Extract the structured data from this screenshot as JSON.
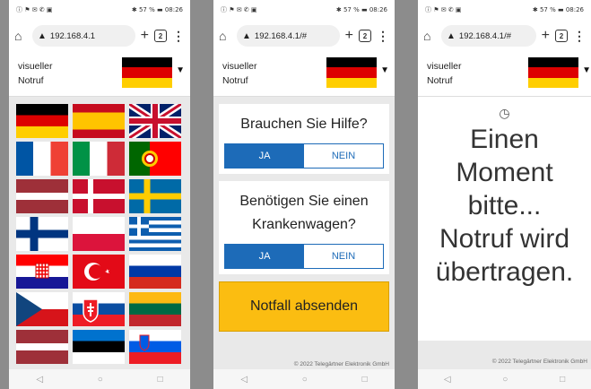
{
  "status_bar": {
    "left": "ⓘ ⚑ ✉ ✆ ▣",
    "right1": "✱ 57 % ▬ 08:26"
  },
  "browser": {
    "url1": "192.168.4.1",
    "url2": "192.168.4.1/#",
    "tabs_count": "2"
  },
  "app": {
    "name_line1": "visueller",
    "name_line2": "Notruf"
  },
  "language_flags": [
    "german-flag",
    "spanish-flag",
    "uk-flag",
    "french-flag",
    "italian-flag",
    "portuguese-flag",
    "latvian-flag",
    "danish-flag",
    "swedish-flag",
    "finnish-flag",
    "polish-flag",
    "greek-flag",
    "croatian-flag",
    "turkish-flag",
    "russian-flag",
    "czech-flag",
    "slovak-flag",
    "lithuanian-flag",
    "austrian-flag",
    "estonian-flag",
    "slovenian-flag"
  ],
  "questions": {
    "q1": "Brauchen Sie Hilfe?",
    "q2_line1": "Benötigen Sie einen",
    "q2_line2": "Krankenwagen?",
    "yes": "JA",
    "no": "NEIN"
  },
  "send_button": "Notfall absenden",
  "footer": "© 2022 Telegärtner Elektronik GmbH",
  "wait": {
    "line1": "Einen",
    "line2": "Moment",
    "line3": "bitte...",
    "line4": "Notruf wird",
    "line5": "übertragen."
  },
  "nav": {
    "back": "◁",
    "home": "○",
    "recent": "□"
  }
}
